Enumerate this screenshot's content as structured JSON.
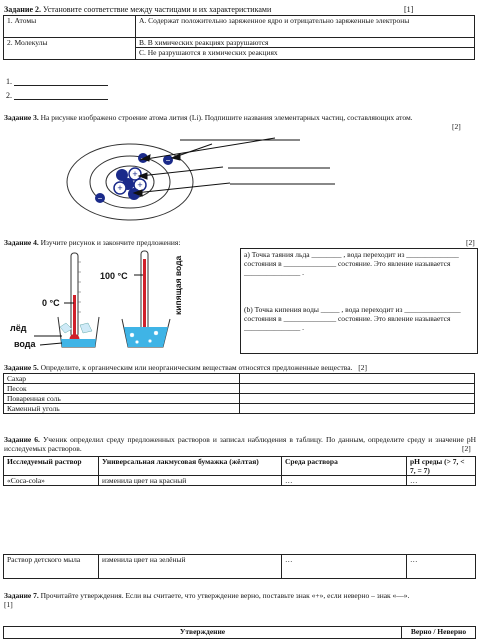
{
  "task2": {
    "header": "Задание 2.",
    "prompt": "Установите соответствие между частицами и их характеристиками",
    "points": "[1]",
    "left": [
      "1. Атомы",
      "2. Молекулы"
    ],
    "right": [
      "A. Содержат положительно заряженное ядро и отрицательно заряженные электроны",
      "B. В химических реакциях разрушаются",
      "C. Не разрушаются в химических реакциях"
    ],
    "answers": [
      "1.",
      "2."
    ]
  },
  "task3": {
    "header": "Задание 3.",
    "prompt": "На рисунке изображено строение атома лития (Li). Подпишите названия элементарных частиц, составляющих атом.",
    "points": "[2]"
  },
  "task4": {
    "header": "Задание 4.",
    "prompt": "Изучите рисунок и закончите предложения:",
    "points": "[2]",
    "labels": {
      "t100": "100 °C",
      "t0": "0 °C",
      "ice": "лёд",
      "water": "вода",
      "boiling": "кипящая вода"
    },
    "a_text": "a) Точка таяния льда ________ , вода переходит из ______________ состояния в ______________ состояние. Это явление называется _______________ .",
    "b_text": "(b) Точка кипения воды _____ , вода переходит из _______________ состояния в ______________ состояние. Это явление называется _______________ ."
  },
  "task5": {
    "header": "Задание 5.",
    "prompt": "Определите, к органическим или неорганическим веществам относятся предложенные вещества.",
    "points": "[2]",
    "rows": [
      "Сахар",
      "Песок",
      "Поваренная соль",
      "Каменный уголь"
    ]
  },
  "task6": {
    "header": "Задание 6.",
    "prompt": "Ученик определил среду предложенных растворов и записал наблюдения в таблицу. По данным, определите среду и значение pH исследуемых растворов.",
    "points": "[2]",
    "columns": [
      "Исследуемый раствор",
      "Универсальная лакмусовая бумажка (жёлтая)",
      "Среда раствора",
      "pH среды (> 7, < 7, = 7)"
    ],
    "rows": [
      [
        "«Coca-cola»",
        "изменила цвет на красный",
        "…",
        "…"
      ],
      [
        "Раствор детского мыла",
        "изменила цвет на зелёный",
        "…",
        "…"
      ]
    ]
  },
  "task7": {
    "header": "Задание 7.",
    "prompt": "Прочитайте утверждения. Если вы считаете, что утверждение верно, поставьте знак «+», если неверно – знак «—».",
    "points": "[1]",
    "columns": [
      "Утверждение",
      "Верно / Неверно"
    ]
  }
}
